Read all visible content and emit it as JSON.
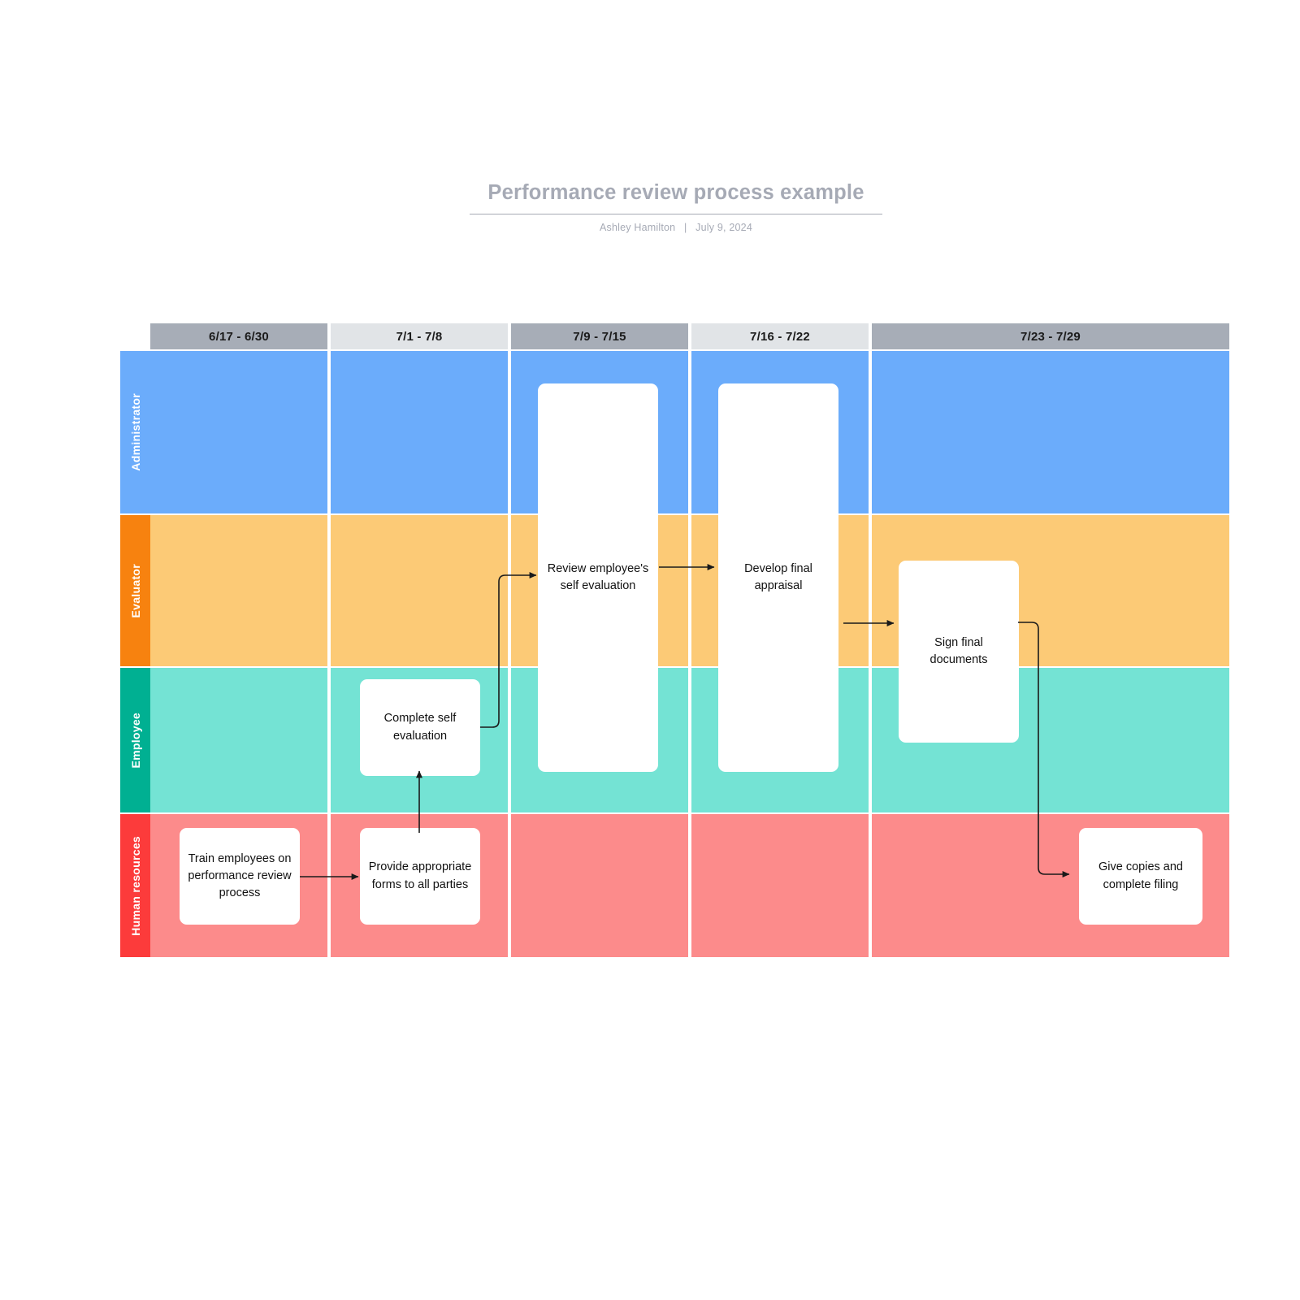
{
  "header": {
    "title": "Performance review process example",
    "author": "Ashley Hamilton",
    "separator": "|",
    "date": "July 9, 2024"
  },
  "diagram": {
    "type": "swimlane",
    "columns": [
      {
        "label": "6/17 - 6/30",
        "style": "dark"
      },
      {
        "label": "7/1 - 7/8",
        "style": "light"
      },
      {
        "label": "7/9 - 7/15",
        "style": "dark"
      },
      {
        "label": "7/16 - 7/22",
        "style": "light"
      },
      {
        "label": "7/23 - 7/29",
        "style": "dark"
      }
    ],
    "lanes": [
      {
        "label": "Administrator",
        "strip_color": "#6BACFB",
        "body_color": "#6BACFB"
      },
      {
        "label": "Evaluator",
        "strip_color": "#F7820F",
        "body_color": "#FCCA76"
      },
      {
        "label": "Employee",
        "strip_color": "#00B092",
        "body_color": "#74E3D4"
      },
      {
        "label": "Human resources",
        "strip_color": "#FC3B3B",
        "body_color": "#FC8B8B"
      }
    ],
    "tasks": [
      {
        "id": "train",
        "text": "Train employees on performance review process",
        "lane": "Human resources",
        "column": "6/17 - 6/30"
      },
      {
        "id": "forms",
        "text": "Provide appropriate forms to all parties",
        "lane": "Human resources",
        "column": "7/1 - 7/8"
      },
      {
        "id": "selfeval",
        "text": "Complete self evaluation",
        "lane": "Employee",
        "column": "7/1 - 7/8"
      },
      {
        "id": "review",
        "text": "Review employee's self evaluation",
        "lane": "Administrator-Employee",
        "column": "7/9 - 7/15"
      },
      {
        "id": "appraise",
        "text": "Develop final appraisal",
        "lane": "Administrator-Employee",
        "column": "7/16 - 7/22"
      },
      {
        "id": "sign",
        "text": "Sign final documents",
        "lane": "Evaluator-Employee",
        "column": "7/23 - 7/29"
      },
      {
        "id": "copies",
        "text": "Give copies and complete filing",
        "lane": "Human resources",
        "column": "7/23 - 7/29"
      }
    ],
    "connections": [
      {
        "from": "train",
        "to": "forms"
      },
      {
        "from": "forms",
        "to": "selfeval"
      },
      {
        "from": "selfeval",
        "to": "review"
      },
      {
        "from": "review",
        "to": "appraise"
      },
      {
        "from": "appraise",
        "to": "sign"
      },
      {
        "from": "sign",
        "to": "copies"
      }
    ]
  }
}
